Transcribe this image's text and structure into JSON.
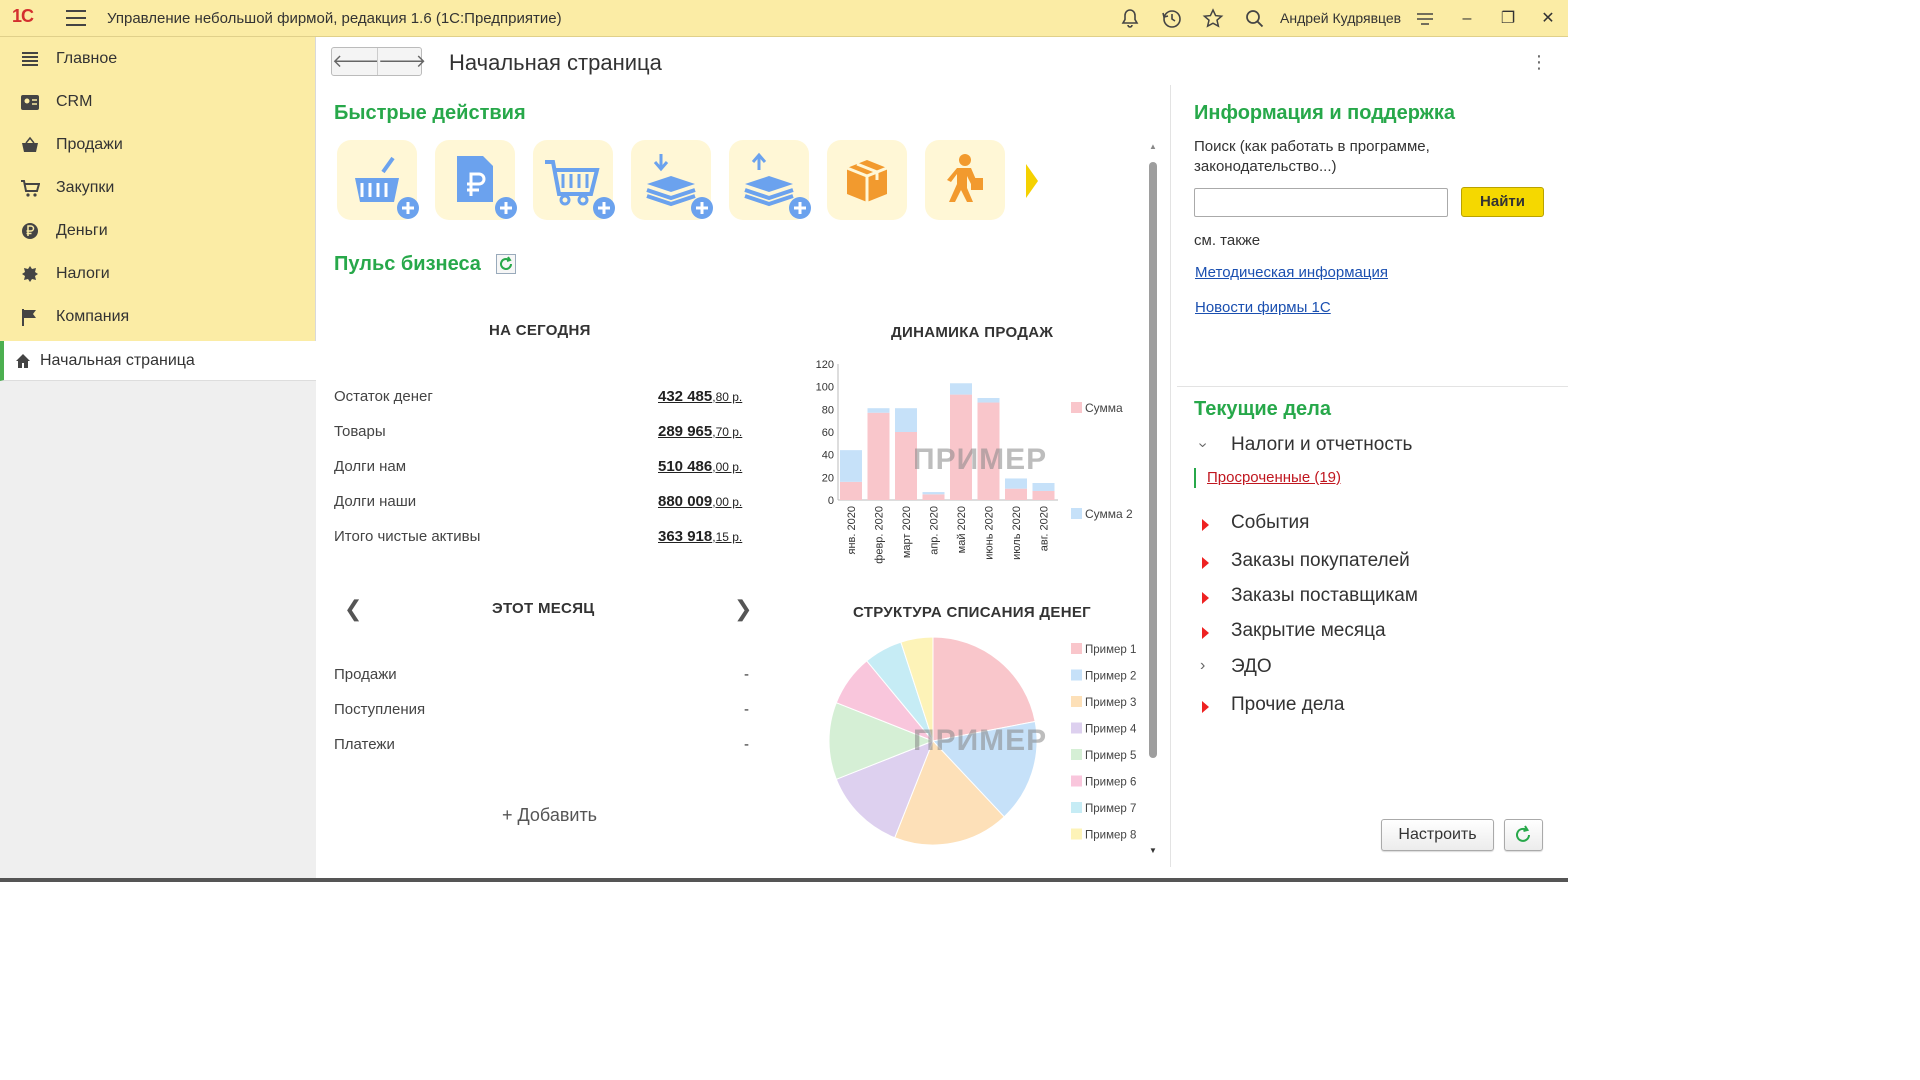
{
  "app": {
    "logo": "1С",
    "title": "Управление небольшой фирмой, редакция 1.6  (1С:Предприятие)",
    "user": "Андрей Кудрявцев"
  },
  "sidebar": {
    "items": [
      {
        "label": "Главное",
        "icon": "list-icon"
      },
      {
        "label": "CRM",
        "icon": "contacts-icon"
      },
      {
        "label": "Продажи",
        "icon": "basket-icon"
      },
      {
        "label": "Закупки",
        "icon": "cart-icon"
      },
      {
        "label": "Деньги",
        "icon": "ruble-coin-icon"
      },
      {
        "label": "Налоги",
        "icon": "emblem-icon"
      },
      {
        "label": "Компания",
        "icon": "flag-icon"
      }
    ],
    "active": {
      "label": "Начальная страница",
      "icon": "home-icon"
    }
  },
  "page": {
    "title": "Начальная страница",
    "quick_actions_title": "Быстрые действия",
    "quick_actions": [
      {
        "icon": "basket-add-icon"
      },
      {
        "icon": "ruble-document-add-icon"
      },
      {
        "icon": "cart-add-icon"
      },
      {
        "icon": "money-in-add-icon"
      },
      {
        "icon": "money-out-add-icon"
      },
      {
        "icon": "box-icon"
      },
      {
        "icon": "courier-icon"
      }
    ],
    "pulse_title": "Пульс бизнеса",
    "today": {
      "title": "НА СЕГОДНЯ",
      "rows": [
        {
          "label": "Остаток денег",
          "value": "432 485",
          "cents": ",80 р."
        },
        {
          "label": "Товары",
          "value": "289 965",
          "cents": ",70 р."
        },
        {
          "label": "Долги нам",
          "value": "510 486",
          "cents": ",00 р."
        },
        {
          "label": "Долги наши",
          "value": "880 009",
          "cents": ",00 р."
        },
        {
          "label": "Итого чистые активы",
          "value": "363 918",
          "cents": ",15 р."
        }
      ]
    },
    "month": {
      "title": "ЭТОТ МЕСЯЦ",
      "rows": [
        {
          "label": "Продажи",
          "value": "-"
        },
        {
          "label": "Поступления",
          "value": "-"
        },
        {
          "label": "Платежи",
          "value": "-"
        }
      ],
      "add_label": "+ Добавить"
    }
  },
  "chart_data": [
    {
      "type": "bar",
      "title": "ДИНАМИКА ПРОДАЖ",
      "watermark": "ПРИМЕР",
      "stacked": true,
      "categories": [
        "янв. 2020",
        "февр. 2020",
        "март 2020",
        "апр. 2020",
        "май 2020",
        "июнь 2020",
        "июль 2020",
        "авг. 2020"
      ],
      "series": [
        {
          "name": "Сумма",
          "color": "#f9c6cb",
          "values": [
            16,
            77,
            60,
            5,
            93,
            86,
            10,
            8
          ]
        },
        {
          "name": "Сумма 2",
          "color": "#c6e1f9",
          "values": [
            28,
            4,
            21,
            2,
            10,
            4,
            9,
            7
          ]
        }
      ],
      "yticks": [
        0,
        20,
        40,
        60,
        80,
        100,
        120
      ],
      "ylim": [
        0,
        120
      ],
      "legend": "right"
    },
    {
      "type": "pie",
      "title": "СТРУКТУРА СПИСАНИЯ ДЕНЕГ",
      "watermark": "ПРИМЕР",
      "slices": [
        {
          "name": "Пример 1",
          "value": 22,
          "color": "#f9c6cb"
        },
        {
          "name": "Пример 2",
          "value": 16,
          "color": "#c6e1f9"
        },
        {
          "name": "Пример 3",
          "value": 18,
          "color": "#fde0b8"
        },
        {
          "name": "Пример 4",
          "value": 13,
          "color": "#ddd0ef"
        },
        {
          "name": "Пример 5",
          "value": 12,
          "color": "#d5efd5"
        },
        {
          "name": "Пример 6",
          "value": 8,
          "color": "#f9c6dc"
        },
        {
          "name": "Пример 7",
          "value": 6,
          "color": "#c6ecf5"
        },
        {
          "name": "Пример 8",
          "value": 5,
          "color": "#fdf3b8"
        }
      ],
      "legend": "right"
    }
  ],
  "info": {
    "title": "Информация и поддержка",
    "search_hint": "Поиск (как работать в программе, законодательство...)",
    "search_value": "",
    "find_label": "Найти",
    "see_also": "см. также",
    "links": [
      "Методическая информация",
      "Новости фирмы 1С"
    ]
  },
  "tasks": {
    "title": "Текущие дела",
    "expanded": {
      "label": "Налоги и отчетность",
      "overdue": "Просроченные (19)"
    },
    "items": [
      {
        "label": "События",
        "marker": "red"
      },
      {
        "label": "Заказы покупателей",
        "marker": "red"
      },
      {
        "label": "Заказы поставщикам",
        "marker": "red"
      },
      {
        "label": "Закрытие месяца",
        "marker": "red"
      },
      {
        "label": "ЭДО",
        "marker": "gray"
      },
      {
        "label": "Прочие дела",
        "marker": "red"
      }
    ],
    "configure_label": "Настроить"
  },
  "colors": {
    "accent_green": "#27a84a",
    "panel_yellow": "#fbeca5",
    "action_yellow": "#f5d800",
    "icon_blue": "#6ba2ee",
    "icon_orange": "#f29a2e"
  }
}
